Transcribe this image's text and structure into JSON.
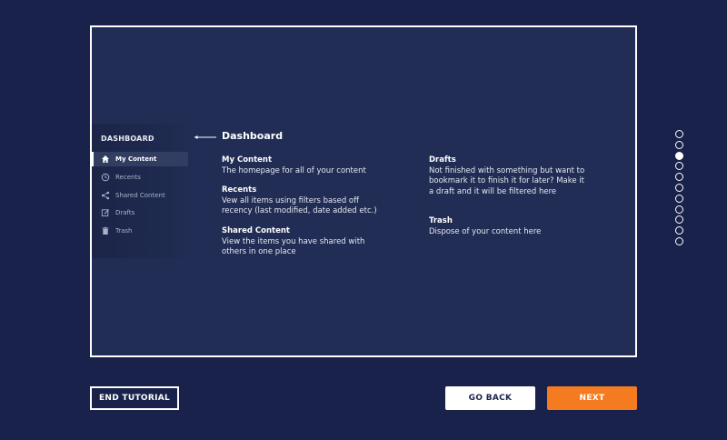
{
  "sidebar": {
    "title": "DASHBOARD",
    "items": [
      {
        "label": "My Content",
        "icon": "home-icon",
        "active": true
      },
      {
        "label": "Recents",
        "icon": "clock-icon",
        "active": false
      },
      {
        "label": "Shared Content",
        "icon": "share-icon",
        "active": false
      },
      {
        "label": "Drafts",
        "icon": "edit-icon",
        "active": false
      },
      {
        "label": "Trash",
        "icon": "trash-icon",
        "active": false
      }
    ]
  },
  "tutorial": {
    "heading": "Dashboard",
    "sections": [
      {
        "title": "My Content",
        "body": "The homepage for all of your content"
      },
      {
        "title": "Recents",
        "body": "Vew all items using filters based off recency (last modified, date added etc.)"
      },
      {
        "title": "Shared Content",
        "body": "View the items you have shared with others in one place"
      },
      {
        "title": "Drafts",
        "body": "Not finished with something but want to bookmark it to finish it for later? Make it a draft and it will be filtered here"
      },
      {
        "title": "Trash",
        "body": "Dispose of your content here"
      }
    ]
  },
  "progress": {
    "total_steps": 11,
    "current_step": 3
  },
  "buttons": {
    "end": "END TUTORIAL",
    "back": "GO BACK",
    "next": "NEXT"
  },
  "colors": {
    "background": "#18224a",
    "panel": "#212d54",
    "accent": "#f47b20"
  }
}
